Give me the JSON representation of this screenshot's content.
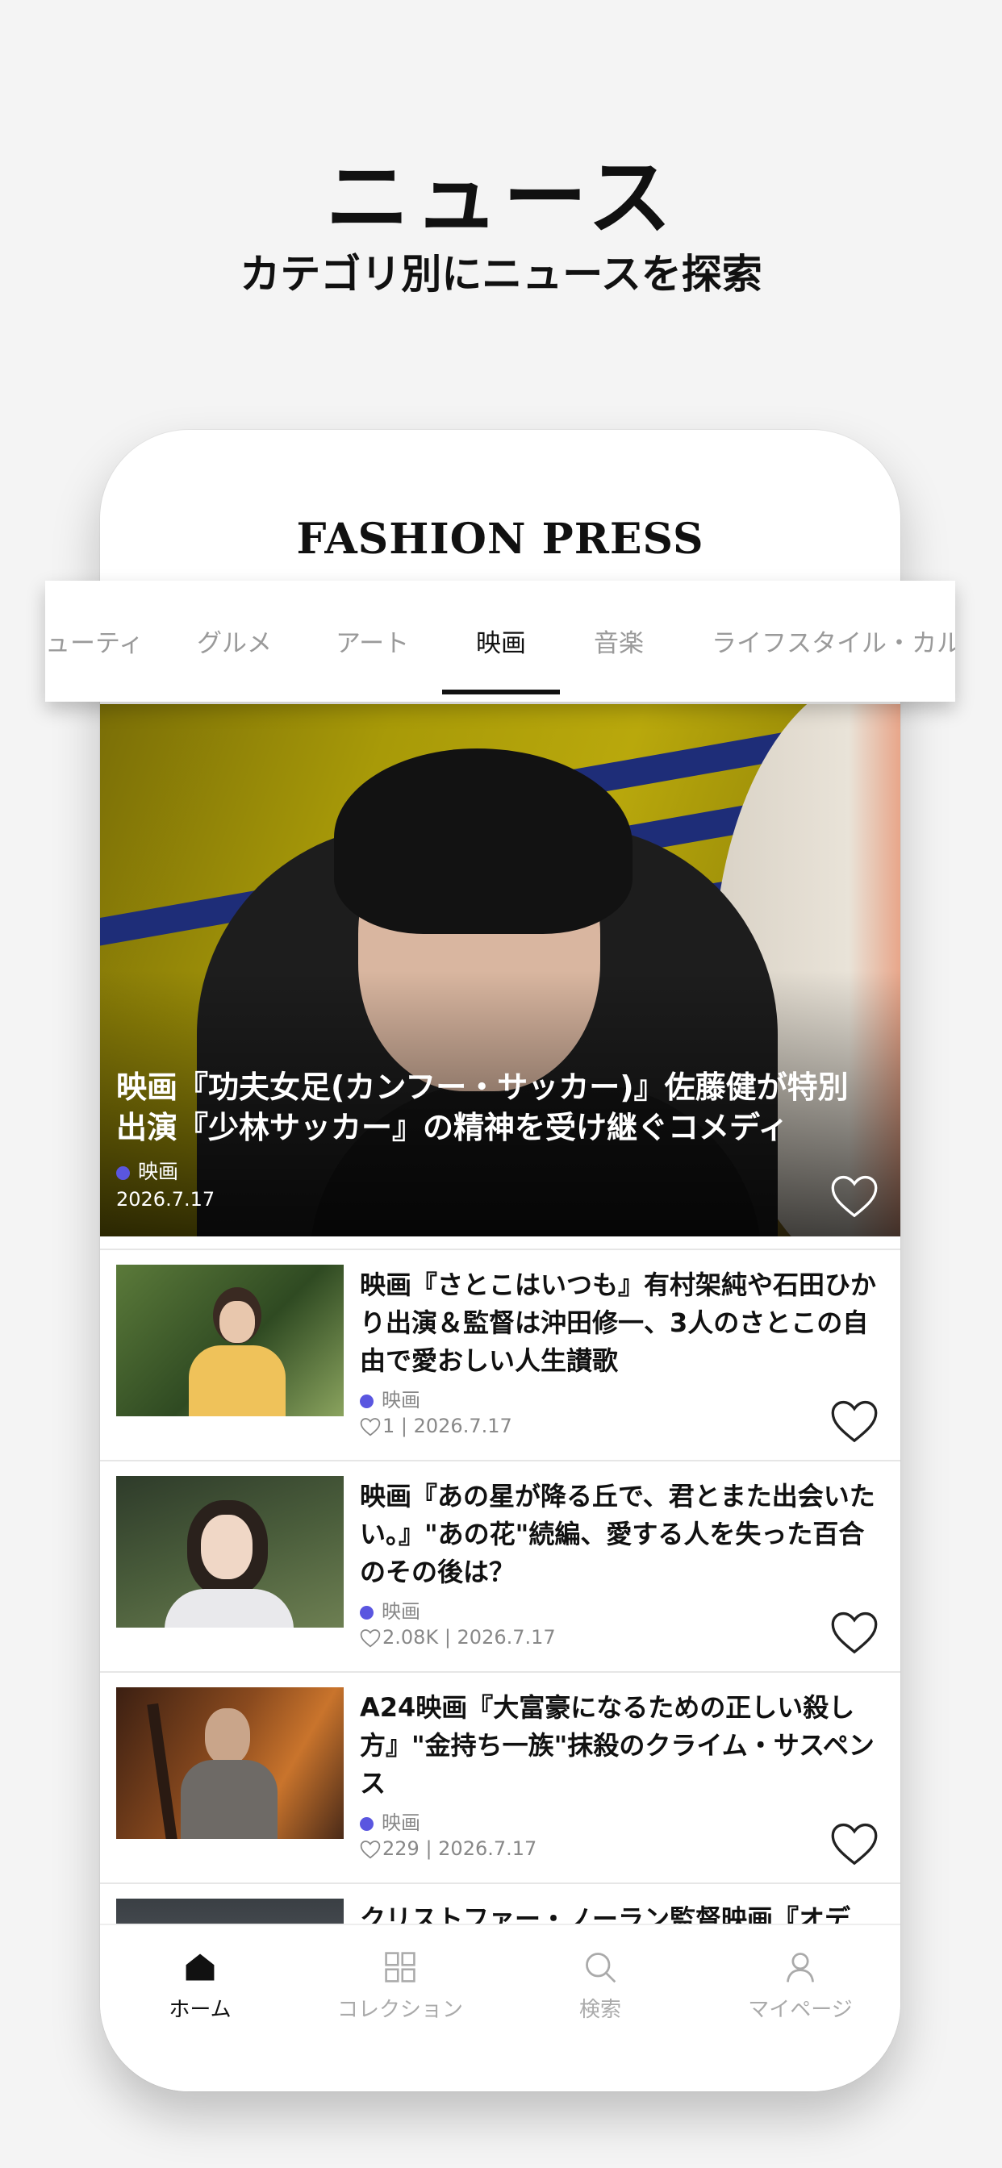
{
  "promo": {
    "title": "ニュース",
    "subtitle": "カテゴリ別にニュースを探索"
  },
  "app": {
    "logo": "FASHION PRESS"
  },
  "categories": {
    "items": [
      "ューティ",
      "グルメ",
      "アート",
      "映画",
      "音楽",
      "ライフスタイル・カルチ"
    ],
    "active": "映画"
  },
  "hero": {
    "title": "映画『功夫女足(カンフー・サッカー)』佐藤健が特別出演『少林サッカー』の精神を受け継ぐコメディ",
    "category": "映画",
    "date": "2026.7.17"
  },
  "articles": [
    {
      "title": "映画『さとこはいつも』有村架純や石田ひかり出演＆監督は沖田修一、3人のさとこの自由で愛おしい人生讃歌",
      "category": "映画",
      "likes": "1",
      "date": "2026.7.17"
    },
    {
      "title": "映画『あの星が降る丘で、君とまた出会いたい。』\"あの花\"続編、愛する人を失った百合のその後は？",
      "category": "映画",
      "likes": "2.08K",
      "date": "2026.7.17"
    },
    {
      "title": "A24映画『大富豪になるための正しい殺し方』\"金持ち一族\"抹殺のクライム・サスペンス",
      "category": "映画",
      "likes": "229",
      "date": "2026.7.17"
    },
    {
      "title": "クリストファー・ノーラン監督映画『オデ"
    }
  ],
  "tabbar": {
    "home": "ホーム",
    "collection": "コレクション",
    "search": "検索",
    "mypage": "マイページ"
  },
  "icons": [
    "home-icon",
    "collection-icon",
    "search-icon",
    "person-icon",
    "heart-icon"
  ],
  "colors": {
    "accent_dot": "#5a56e0",
    "background": "#f4f4f4"
  }
}
